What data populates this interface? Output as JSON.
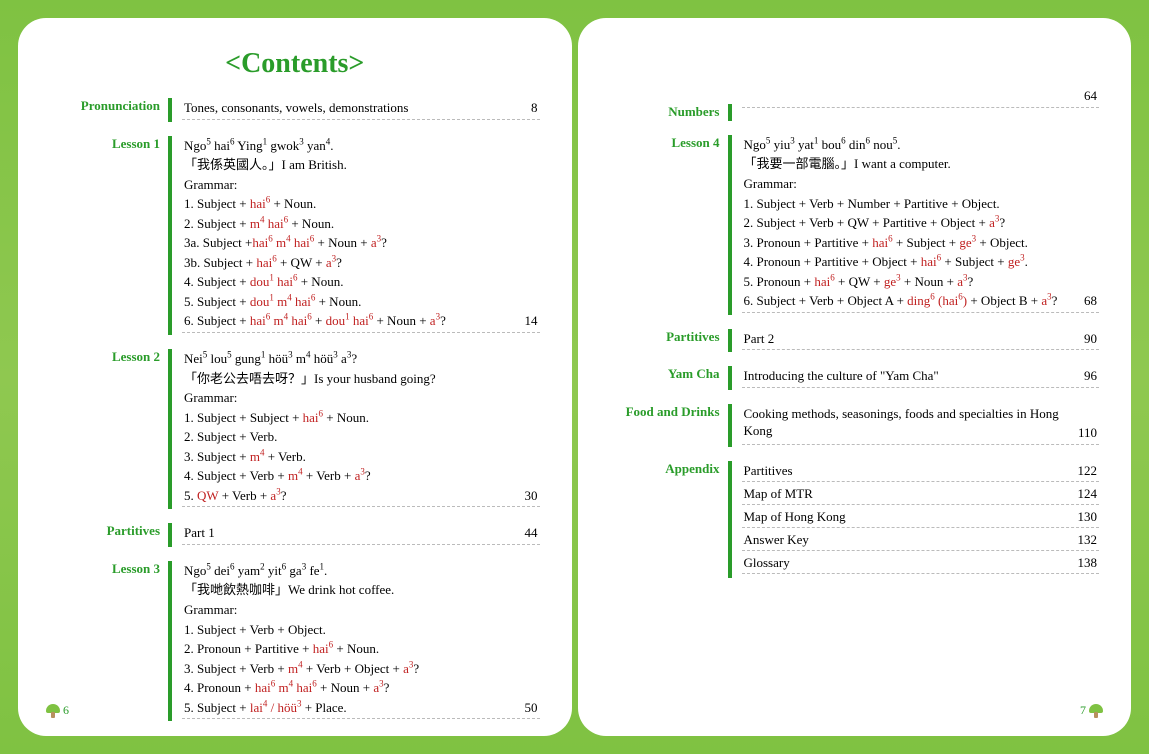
{
  "title": "<Contents>",
  "left": {
    "pronunciation": {
      "label": "Pronunciation",
      "text": "Tones, consonants, vowels, demonstrations",
      "page": "8"
    },
    "lesson1": {
      "label": "Lesson 1",
      "line1": "Ngo<sup>5</sup> hai<sup>6</sup> Ying<sup>1</sup> gwok<sup>3</sup> yan<sup>4</sup>.",
      "line2": "「我係英國人。」I am British.",
      "grammar_label": "Grammar:",
      "g1": "1. Subject + <span class='red'>hai<sup>6</sup></span> + Noun.",
      "g2": "2. Subject + <span class='red'>m<sup>4</sup> hai<sup>6</sup></span> + Noun.",
      "g3a": "3a. Subject +<span class='red'>hai<sup>6</sup> m<sup>4</sup> hai<sup>6</sup></span> + Noun + <span class='red'>a<sup>3</sup></span>?",
      "g3b": "3b. Subject + <span class='red'>hai<sup>6</sup></span> + QW + <span class='red'>a<sup>3</sup></span>?",
      "g4": "4. Subject + <span class='red'>dou<sup>1</sup> hai<sup>6</sup></span> + Noun.",
      "g5": "5. Subject + <span class='red'>dou<sup>1</sup> m<sup>4</sup> hai<sup>6</sup></span> + Noun.",
      "g6": "6. Subject + <span class='red'>hai<sup>6</sup> m<sup>4</sup> hai<sup>6</sup></span> + <span class='red'>dou<sup>1</sup> hai<sup>6</sup></span> + Noun + <span class='red'>a<sup>3</sup></span>?",
      "page": "14"
    },
    "lesson2": {
      "label": "Lesson 2",
      "line1": "Nei<sup>5</sup> lou<sup>5</sup> gung<sup>1</sup> höü<sup>3</sup> m<sup>4</sup> höü<sup>3</sup> a<sup>3</sup>?",
      "line2": "「你老公去唔去呀？」Is your husband going?",
      "grammar_label": "Grammar:",
      "g1": "1. Subject + Subject + <span class='red'>hai<sup>6</sup></span> + Noun.",
      "g2": "2. Subject + Verb.",
      "g3": "3. Subject + <span class='red'>m<sup>4</sup></span> + Verb.",
      "g4": "4. Subject + Verb + <span class='red'>m<sup>4</sup></span> + Verb + <span class='red'>a<sup>3</sup></span>?",
      "g5": "5. <span class='red'>QW</span> + Verb + <span class='red'>a<sup>3</sup></span>?",
      "page": "30"
    },
    "partitives1": {
      "label": "Partitives",
      "text": "Part 1",
      "page": "44"
    },
    "lesson3": {
      "label": "Lesson 3",
      "line1": "Ngo<sup>5</sup> dei<sup>6</sup> yam<sup>2</sup> yit<sup>6</sup> ga<sup>3</sup> fe<sup>1</sup>.",
      "line2": "「我哋飲熱咖啡」We drink hot coffee.",
      "grammar_label": "Grammar:",
      "g1": "1. Subject + Verb + Object.",
      "g2": "2. Pronoun + Partitive + <span class='red'>hai<sup>6</sup></span> + Noun.",
      "g3": "3. Subject + Verb + <span class='red'>m<sup>4</sup></span> + Verb + Object + <span class='red'>a<sup>3</sup></span>?",
      "g4": "4. Pronoun + <span class='red'>hai<sup>6</sup> m<sup>4</sup> hai<sup>6</sup></span> + Noun + <span class='red'>a<sup>3</sup></span>?",
      "g5": "5. Subject + <span class='red'>lai<sup>4</sup> / höü<sup>3</sup></span> + Place.",
      "page": "50"
    },
    "footer_page": "6"
  },
  "right": {
    "numbers": {
      "label": "Numbers",
      "text": "",
      "page": "64"
    },
    "lesson4": {
      "label": "Lesson 4",
      "line1": "Ngo<sup>5</sup> yiu<sup>3</sup> yat<sup>1</sup> bou<sup>6</sup> din<sup>6</sup> nou<sup>5</sup>.",
      "line2": "「我要一部電腦。」I want a computer.",
      "grammar_label": "Grammar:",
      "g1": "1. Subject + Verb + Number + Partitive + Object.",
      "g2": "2. Subject + Verb + QW + Partitive + Object + <span class='red'>a<sup>3</sup></span>?",
      "g3": "3. Pronoun + Partitive + <span class='red'>hai<sup>6</sup></span> + Subject + <span class='red'>ge<sup>3</sup></span> + Object.",
      "g4": "4. Pronoun + Partitive + Object + <span class='red'>hai<sup>6</sup></span> + Subject + <span class='red'>ge<sup>3</sup></span>.",
      "g5": "5. Pronoun + <span class='red'>hai<sup>6</sup></span> + QW + <span class='red'>ge<sup>3</sup></span> + Noun + <span class='red'>a<sup>3</sup></span>?",
      "g6": "6. Subject + Verb + Object A + <span class='red'>ding<sup>6</sup> (hai<sup>6</sup>)</span> + Object B + <span class='red'>a<sup>3</sup></span>?",
      "page": "68"
    },
    "partitives2": {
      "label": "Partitives",
      "text": "Part 2",
      "page": "90"
    },
    "yamcha": {
      "label": "Yam Cha",
      "text": "Introducing the culture of \"Yam Cha\"",
      "page": "96"
    },
    "food": {
      "label": "Food and Drinks",
      "text": "Cooking methods, seasonings, foods and specialties in Hong Kong",
      "page": "110"
    },
    "appendix": {
      "label": "Appendix",
      "items": [
        {
          "text": "Partitives",
          "page": "122"
        },
        {
          "text": "Map of MTR",
          "page": "124"
        },
        {
          "text": "Map of Hong Kong",
          "page": "130"
        },
        {
          "text": "Answer Key",
          "page": "132"
        },
        {
          "text": "Glossary",
          "page": "138"
        }
      ]
    },
    "footer_page": "7"
  }
}
